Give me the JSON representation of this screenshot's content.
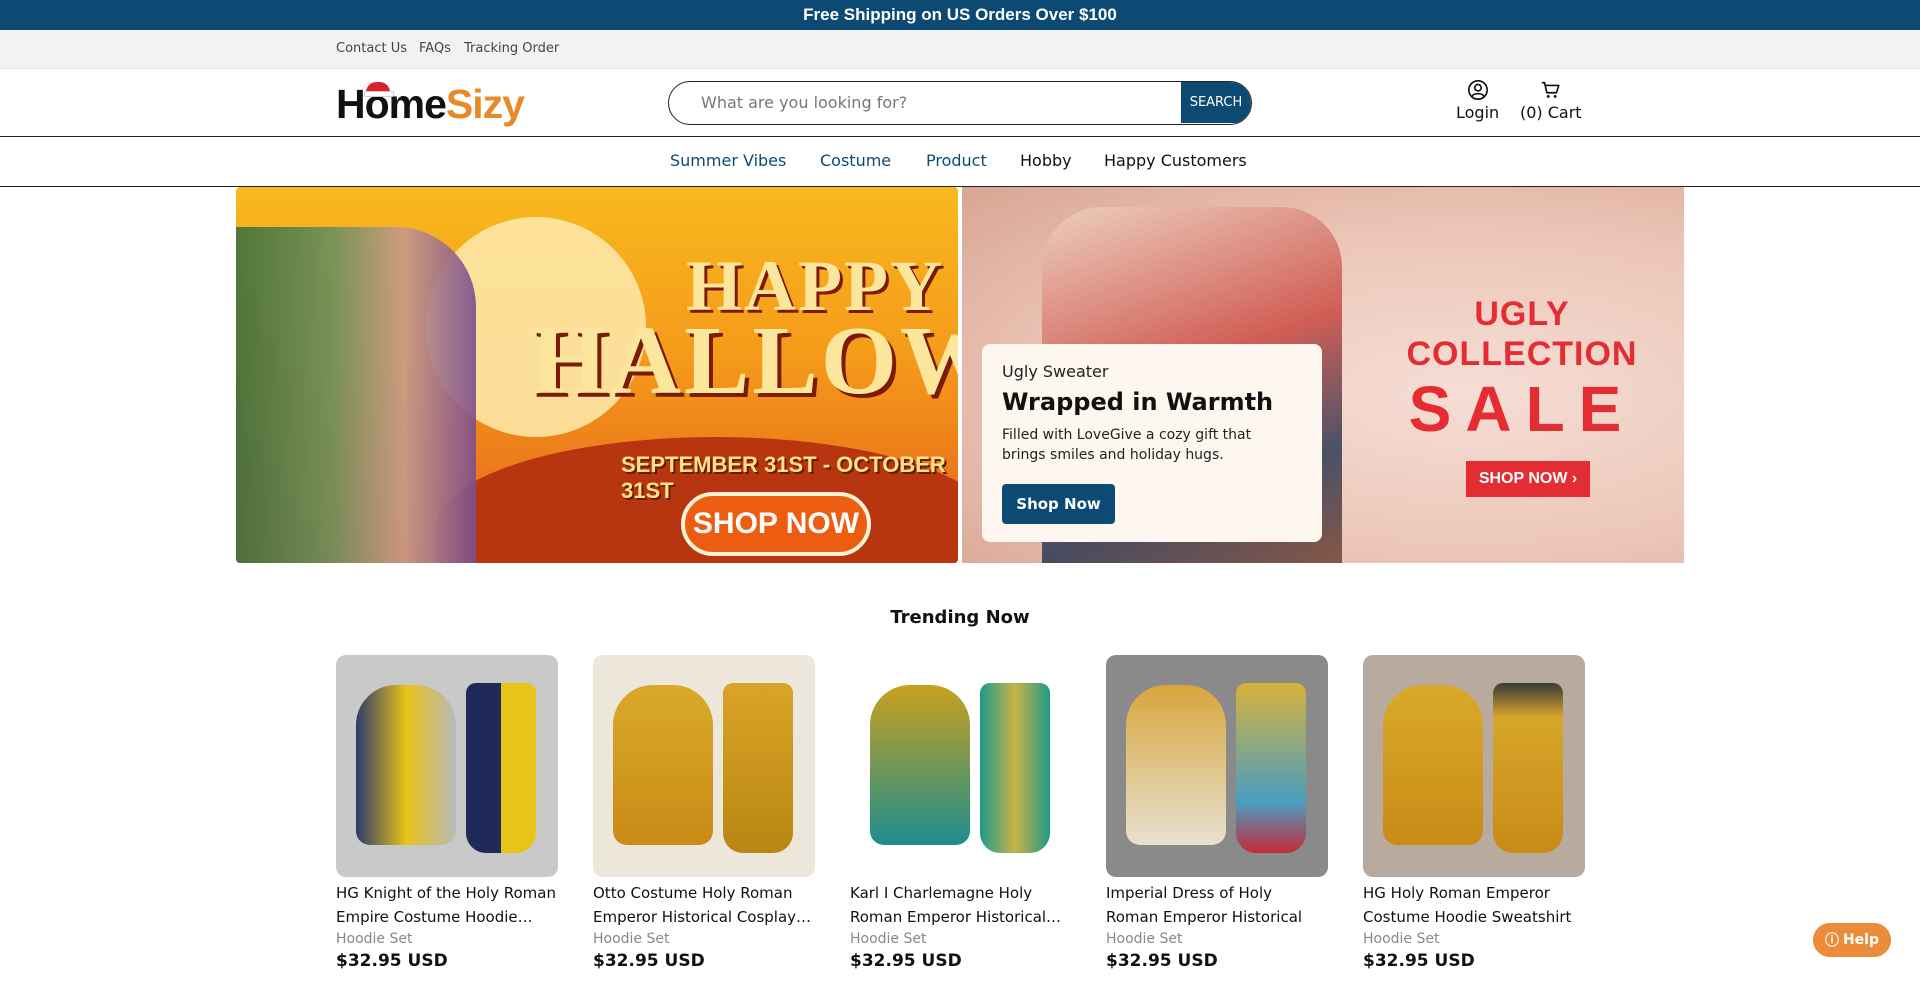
{
  "announcement": "Free Shipping on US Orders Over $100",
  "utility_links": [
    "Contact Us",
    "FAQs",
    "Tracking Order"
  ],
  "logo": {
    "part1": "Home",
    "part2": "Sizy"
  },
  "search": {
    "placeholder": "What are you looking for?",
    "button": "SEARCH"
  },
  "header": {
    "login": "Login",
    "cart": "(0) Cart"
  },
  "nav": [
    "Summer Vibes",
    "Costume",
    "Product",
    "Hobby",
    "Happy Customers"
  ],
  "banner_halloween": {
    "line1": "HAPPY",
    "line2": "HALLOWEE",
    "dates": "SEPTEMBER 31ST - OCTOBER 31ST",
    "button": "SHOP NOW"
  },
  "banner_sweater": {
    "subtitle": "Ugly Sweater",
    "title": "Wrapped in Warmth",
    "description": "Filled with LoveGive a cozy gift that brings smiles and holiday hugs.",
    "button": "Shop Now",
    "sale_line1": "UGLY",
    "sale_line2": "COLLECTION",
    "sale_line3": "SALE",
    "sale_button": "SHOP NOW ›"
  },
  "trending": {
    "title": "Trending Now",
    "products": [
      {
        "name": "HG Knight of the Holy Roman Empire Costume Hoodie…",
        "category": "Hoodie Set",
        "price": "$32.95 USD"
      },
      {
        "name": "Otto Costume Holy Roman Emperor Historical Cosplay…",
        "category": "Hoodie Set",
        "price": "$32.95 USD"
      },
      {
        "name": "Karl I Charlemagne Holy Roman Emperor Historical…",
        "category": "Hoodie Set",
        "price": "$32.95 USD"
      },
      {
        "name": "Imperial Dress of Holy Roman Emperor Historical Cosplay…",
        "category": "Hoodie Set",
        "price": "$32.95 USD"
      },
      {
        "name": "HG Holy Roman Emperor Costume Hoodie Sweatshirt T…",
        "category": "Hoodie Set",
        "price": "$32.95 USD"
      }
    ]
  },
  "help": "Help",
  "colors": {
    "brand": "#0d4a73",
    "accent": "#e8892a",
    "sale_red": "#e32d33"
  }
}
